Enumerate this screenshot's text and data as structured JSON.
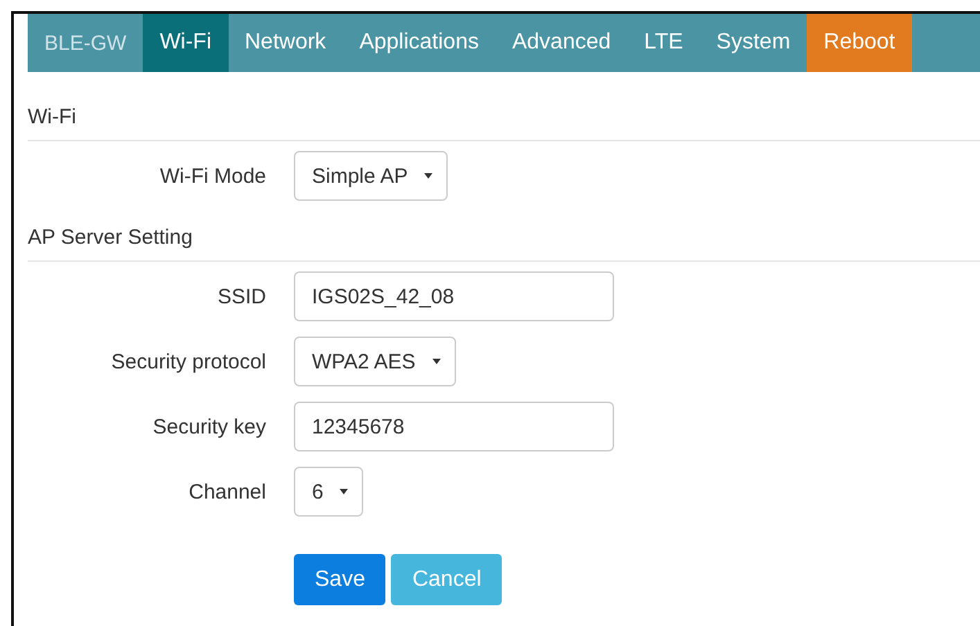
{
  "tabs": [
    {
      "label": "BLE-GW",
      "kind": "brand",
      "selected": false
    },
    {
      "label": "Wi-Fi",
      "kind": "tab",
      "selected": true
    },
    {
      "label": "Network",
      "kind": "tab",
      "selected": false
    },
    {
      "label": "Applications",
      "kind": "tab",
      "selected": false
    },
    {
      "label": "Advanced",
      "kind": "tab",
      "selected": false
    },
    {
      "label": "LTE",
      "kind": "tab",
      "selected": false
    },
    {
      "label": "System",
      "kind": "tab",
      "selected": false
    },
    {
      "label": "Reboot",
      "kind": "action",
      "selected": false
    }
  ],
  "sections": [
    {
      "title": "Wi-Fi",
      "rows": [
        {
          "label": "Wi-Fi Mode",
          "kind": "select",
          "value": "Simple AP"
        }
      ]
    },
    {
      "title": "AP Server Setting",
      "rows": [
        {
          "label": "SSID",
          "kind": "input",
          "value": "IGS02S_42_08"
        },
        {
          "label": "Security protocol",
          "kind": "select",
          "value": "WPA2 AES"
        },
        {
          "label": "Security key",
          "kind": "input",
          "value": "12345678"
        },
        {
          "label": "Channel",
          "kind": "select",
          "value": "6"
        }
      ]
    }
  ],
  "buttons": [
    {
      "label": "Save",
      "kind": "primary"
    },
    {
      "label": "Cancel",
      "kind": "secondary"
    }
  ]
}
